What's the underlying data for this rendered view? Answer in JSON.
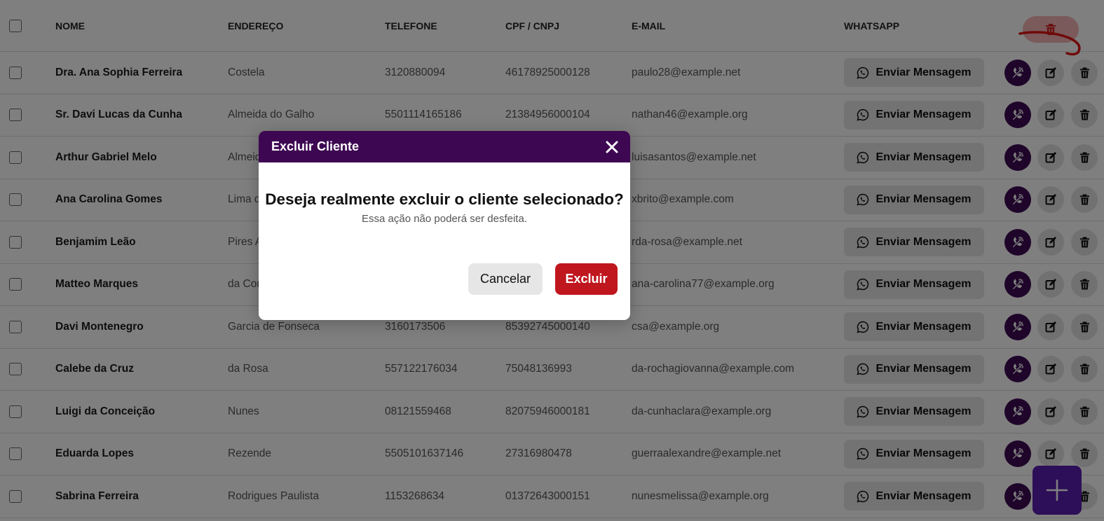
{
  "table": {
    "columns": [
      "NOME",
      "ENDEREÇO",
      "TELEFONE",
      "CPF / CNPJ",
      "E-MAIL",
      "WHATSAPP"
    ],
    "whatsapp_button_label": "Enviar Mensagem",
    "rows": [
      {
        "nome": "Dra. Ana Sophia Ferreira",
        "endereco": "Costela",
        "telefone": "3120880094",
        "cpf_cnpj": "46178925000128",
        "email": "paulo28@example.net"
      },
      {
        "nome": "Sr. Davi Lucas da Cunha",
        "endereco": "Almeida do Galho",
        "telefone": "5501114165186",
        "cpf_cnpj": "21384956000104",
        "email": "nathan46@example.org"
      },
      {
        "nome": "Arthur Gabriel Melo",
        "endereco": "Almeida",
        "telefone": "",
        "cpf_cnpj": "",
        "email": "luisasantos@example.net"
      },
      {
        "nome": "Ana Carolina Gomes",
        "endereco": "Lima d",
        "telefone": "",
        "cpf_cnpj": "",
        "email": "xbrito@example.com"
      },
      {
        "nome": "Benjamim Leão",
        "endereco": "Pires A",
        "telefone": "",
        "cpf_cnpj": "",
        "email": "rda-rosa@example.net"
      },
      {
        "nome": "Matteo Marques",
        "endereco": "da Cor",
        "telefone": "",
        "cpf_cnpj": "",
        "email": "ana-carolina77@example.org"
      },
      {
        "nome": "Davi Montenegro",
        "endereco": "Garcia de Fonseca",
        "telefone": "3160173506",
        "cpf_cnpj": "85392745000140",
        "email": "csa@example.org"
      },
      {
        "nome": "Calebe da Cruz",
        "endereco": "da Rosa",
        "telefone": "557122176034",
        "cpf_cnpj": "75048136993",
        "email": "da-rochagiovanna@example.com"
      },
      {
        "nome": "Luigi da Conceição",
        "endereco": "Nunes",
        "telefone": "08121559468",
        "cpf_cnpj": "82075946000181",
        "email": "da-cunhaclara@example.org"
      },
      {
        "nome": "Eduarda Lopes",
        "endereco": "Rezende",
        "telefone": "5505101637146",
        "cpf_cnpj": "27316980478",
        "email": "guerraalexandre@example.net"
      },
      {
        "nome": "Sabrina Ferreira",
        "endereco": "Rodrigues Paulista",
        "telefone": "1153268634",
        "cpf_cnpj": "01372643000151",
        "email": "nunesmelissa@example.org"
      }
    ]
  },
  "modal": {
    "title": "Excluir Cliente",
    "question": "Deseja realmente excluir o cliente selecionado?",
    "subtitle": "Essa ação não poderá ser desfeita.",
    "cancel_label": "Cancelar",
    "confirm_label": "Excluir"
  },
  "icons": {
    "whatsapp": "whatsapp-icon",
    "call": "phone-call-icon",
    "edit": "edit-icon",
    "delete": "trash-icon",
    "add": "plus-icon",
    "close": "close-icon"
  },
  "colors": {
    "primary": "#3d0752",
    "danger": "#c0161e",
    "fab": "#5b1db0"
  }
}
